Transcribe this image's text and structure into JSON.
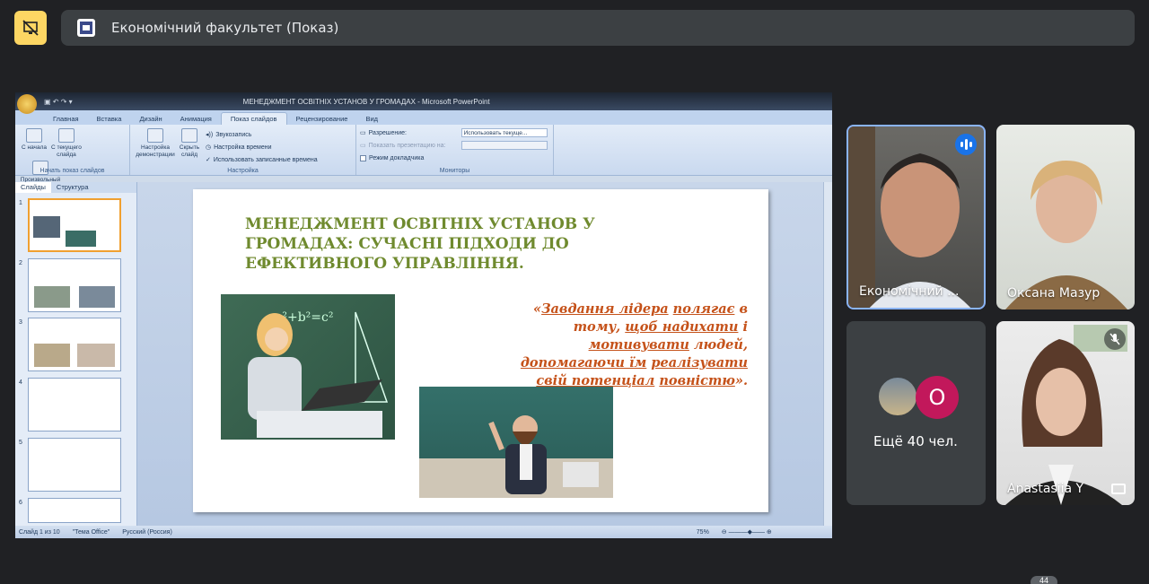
{
  "meeting": {
    "title": "Економічний факультет (Показ)"
  },
  "ppt": {
    "window_title": "МЕНЕДЖМЕНТ ОСВІТНІХ УСТАНОВ У ГРОМАДАХ - Microsoft PowerPoint",
    "tabs": [
      "Главная",
      "Вставка",
      "Дизайн",
      "Анимация",
      "Показ слайдов",
      "Рецензирование",
      "Вид"
    ],
    "active_tab": "Показ слайдов",
    "ribbon": {
      "btn_from_start": "С начала",
      "btn_from_current": "С текущего слайда",
      "btn_custom": "Произвольный показ",
      "group_start": "Начать показ слайдов",
      "btn_setup": "Настройка демонстрации",
      "btn_hide": "Скрыть слайд",
      "opt_record": "Звукозапись",
      "opt_timing": "Настройка времени",
      "opt_use_timings": "Использовать записанные времена",
      "group_setup": "Настройка",
      "resolution_label": "Разрешение:",
      "resolution_value": "Использовать текуще...",
      "show_on_label": "Показать презентацию на:",
      "presenter_mode": "Режим докладчика",
      "group_monitors": "Мониторы"
    },
    "pane_tabs": [
      "Слайды",
      "Структура"
    ],
    "slide_numbers": [
      "1",
      "2",
      "3",
      "4",
      "5",
      "6"
    ],
    "status": {
      "slide": "Слайд 1 из 10",
      "theme": "\"Тема Office\"",
      "language": "Русский (Россия)",
      "zoom": "75%"
    }
  },
  "slide": {
    "title": "МЕНЕДЖМЕНТ ОСВІТНІХ УСТАНОВ У ГРОМАДАХ: СУЧАСНІ ПІДХОДИ ДО ЕФЕКТИВНОГО УПРАВЛІННЯ.",
    "quote_parts": [
      "«",
      "Завдання лідера",
      "полягає",
      " в тому, ",
      "щоб надихати",
      " і ",
      "мотивувати",
      " людей, ",
      "допомагаючи їм",
      "реалізувати свій потенціал",
      "повністю",
      "»."
    ]
  },
  "participants": [
    {
      "name": "Економічний ...",
      "speaking": true
    },
    {
      "name": "Оксана Мазур"
    },
    {
      "more": "Ещё 40 чел.",
      "avatar_letter": "O"
    },
    {
      "name": "Anastasiia Y",
      "muted": true
    }
  ],
  "bottom_count": "44"
}
